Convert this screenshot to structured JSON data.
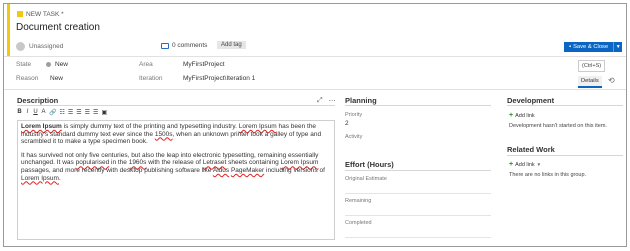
{
  "header": {
    "type_label": "NEW TASK *",
    "title": "Document creation",
    "assignee": "Unassigned",
    "comments": "0 comments",
    "add_tag": "Add tag",
    "save_label": "Save & Close",
    "save_dropdown_icon": "chevron-down-icon"
  },
  "fields": {
    "state_label": "State",
    "state_value": "New",
    "reason_label": "Reason",
    "reason_value": "New",
    "area_label": "Area",
    "area_value": "MyFirstProject",
    "iteration_label": "Iteration",
    "iteration_value": "MyFirstProject\\Iteration 1"
  },
  "tabs": {
    "tooltip": "(Ctrl+S)",
    "details": "Details",
    "history_icon": "history-icon"
  },
  "description": {
    "heading": "Description",
    "toolbar": [
      "B",
      "I",
      "U",
      "A",
      "🔗",
      "☷",
      "☰",
      "☰",
      "☰",
      "☰",
      "▣"
    ],
    "p1": [
      {
        "t": "Lorem Ipsum",
        "s": "bw"
      },
      {
        "t": " is simply dummy text of the printing and typesetting industry. ",
        "s": ""
      },
      {
        "t": "Lorem Ipsum",
        "s": "w"
      },
      {
        "t": " has been the industry's standard dummy text ever since the ",
        "s": ""
      },
      {
        "t": "1500s",
        "s": "w"
      },
      {
        "t": ", when an unknown printer took a galley of type and scrambled it to make a type specimen book.",
        "s": ""
      }
    ],
    "p2": [
      {
        "t": "It has survived not only five centuries, but also the leap into electronic typesetting, remaining essentially unchanged. It was ",
        "s": ""
      },
      {
        "t": "popularised",
        "s": "w"
      },
      {
        "t": " in the ",
        "s": ""
      },
      {
        "t": "1960s",
        "s": "w"
      },
      {
        "t": " with the release of ",
        "s": ""
      },
      {
        "t": "Letraset",
        "s": "w"
      },
      {
        "t": " sheets containing ",
        "s": ""
      },
      {
        "t": "Lorem Ipsum",
        "s": "w"
      },
      {
        "t": " passages, and more recently with desktop publishing software like ",
        "s": ""
      },
      {
        "t": "Aldus",
        "s": "w"
      },
      {
        "t": " ",
        "s": ""
      },
      {
        "t": "PageMaker",
        "s": "w"
      },
      {
        "t": " including versions of ",
        "s": ""
      },
      {
        "t": "Lorem Ipsum",
        "s": "w"
      },
      {
        "t": ".",
        "s": ""
      }
    ]
  },
  "planning": {
    "heading": "Planning",
    "priority_label": "Priority",
    "priority_value": "2",
    "activity_label": "Activity"
  },
  "effort": {
    "heading": "Effort (Hours)",
    "original_estimate": "Original Estimate",
    "remaining": "Remaining",
    "completed": "Completed"
  },
  "development": {
    "heading": "Development",
    "add_link": "Add link",
    "info": "Development hasn't started on this item."
  },
  "related": {
    "heading": "Related Work",
    "add_link": "Add link",
    "info": "There are no links in this group."
  }
}
